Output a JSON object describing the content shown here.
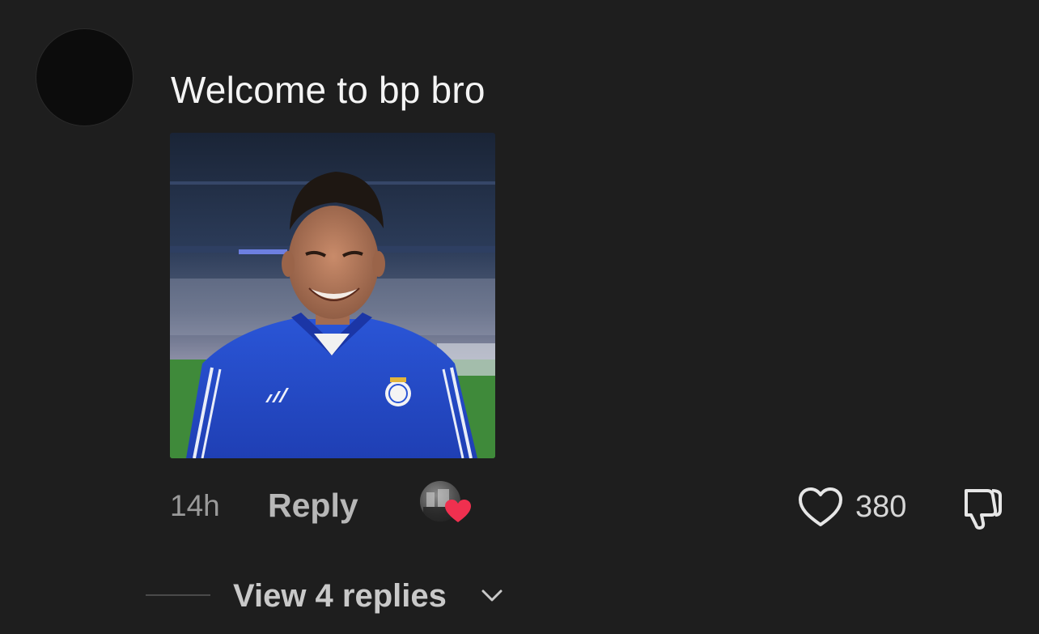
{
  "comment": {
    "text": "Welcome to bp bro",
    "timestamp": "14h",
    "reply_label": "Reply",
    "likes": "380",
    "view_replies_label": "View 4 replies",
    "media_icon": "photo-attachment",
    "creator_liked": true,
    "liked": false
  },
  "colors": {
    "background": "#1e1e1e",
    "text": "#f4f4f4",
    "muted": "#9a9a9a",
    "heart_red": "#f0304f"
  },
  "icons": {
    "like": "heart-outline-icon",
    "dislike": "thumbs-down-outline-icon",
    "creator_heart": "heart-filled-icon",
    "expand": "chevron-down-icon"
  }
}
